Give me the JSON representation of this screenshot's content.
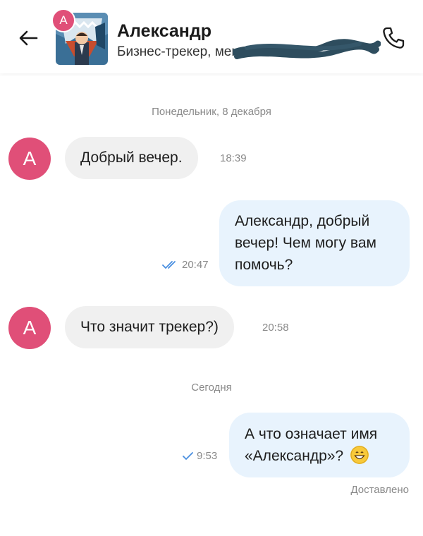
{
  "header": {
    "badge_letter": "А",
    "name": "Александр",
    "status": "Бизнес-трекер, мент",
    "icons": {
      "back": "arrow-left-icon",
      "call": "phone-icon"
    }
  },
  "messages": {
    "date1": "Понедельник, 8 декабря",
    "m1": {
      "avatar": "А",
      "text": "Добрый вечер.",
      "time": "18:39"
    },
    "m2": {
      "line1": "Александр, добрый",
      "line2": "вечер! Чем могу вам",
      "line3": "помочь?",
      "time": "20:47",
      "status_icon": "double-check-icon"
    },
    "m3": {
      "avatar": "А",
      "text": "Что значит трекер?)",
      "time": "20:58"
    },
    "date2": "Сегодня",
    "m4": {
      "line1": "А что означает имя",
      "line2": "«Александр»? ",
      "emoji": "grinning-face-icon",
      "time": "9:53",
      "status_icon": "single-check-icon"
    },
    "delivered": "Доставлено"
  },
  "colors": {
    "accent": "#e04f78",
    "outgoing_bubble": "#e8f3fd",
    "incoming_bubble": "#f0f0f0",
    "tick": "#4a8fe0"
  }
}
